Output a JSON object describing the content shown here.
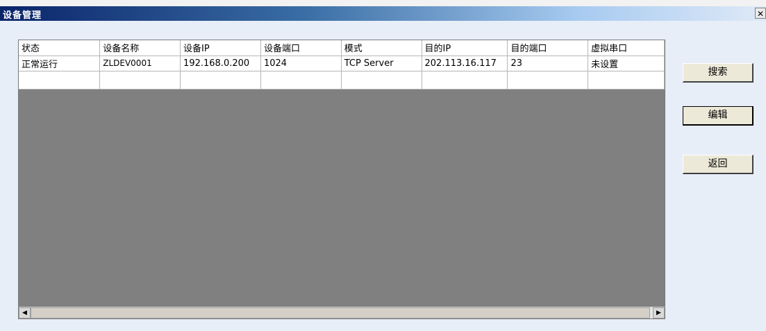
{
  "window": {
    "title": "设备管理",
    "close_glyph": "✕",
    "close_icon": "close-icon"
  },
  "grid": {
    "columns": [
      "状态",
      "设备名称",
      "设备IP",
      "设备端口",
      "模式",
      "目的IP",
      "目的端口",
      "虚拟串口"
    ],
    "rows": [
      [
        "正常运行",
        "ZLDEV0001",
        "192.168.0.200",
        "1024",
        "TCP Server",
        "202.113.16.117",
        "23",
        "未设置"
      ],
      [
        "",
        "",
        "",
        "",
        "",
        "",
        "",
        ""
      ]
    ]
  },
  "scrollbar": {
    "left_glyph": "◀",
    "right_glyph": "▶"
  },
  "buttons": {
    "search": "搜索",
    "edit": "编辑",
    "back": "返回"
  },
  "colors": {
    "title_gradient_start": "#0a246a",
    "title_gradient_end": "#dfe9f7",
    "window_bg": "#e7eef8",
    "grid_empty_area": "#808080",
    "button_face": "#ece9d8"
  }
}
